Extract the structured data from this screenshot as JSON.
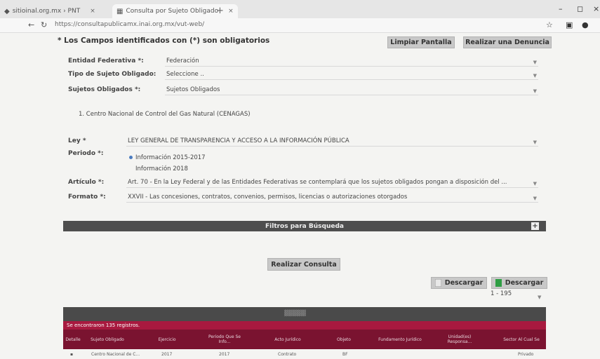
{
  "browser": {
    "tabs": [
      {
        "label": "sitioinal.org.mx › PNT",
        "active": false
      },
      {
        "label": "Consulta por Sujeto Obligado",
        "active": true
      }
    ],
    "url": "https://consultapublicamx.inai.org.mx/vut-web/"
  },
  "form": {
    "required_note": "* Los Campos identificados con (*) son obligatorios",
    "clear_button": "Limpiar Pantalla",
    "complaint_button": "Realizar una Denuncia",
    "entidad_label": "Entidad Federativa *:",
    "entidad_value": "Federación",
    "tipo_label": "Tipo de Sujeto Obligado:",
    "tipo_value": "Seleccione ..",
    "sujetos_label": "Sujetos Obligados *:",
    "sujetos_value": "Sujetos Obligados",
    "selected_subject": "1. Centro Nacional de Control del Gas Natural (CENAGAS)",
    "ley_label": "Ley *",
    "ley_value": "LEY GENERAL DE TRANSPARENCIA Y ACCESO A LA INFORMACIÓN PÚBLICA",
    "periodo_label": "Periodo *:",
    "periodo_options": [
      "Información 2015-2017",
      "Información 2018"
    ],
    "articulo_label": "Artículo *:",
    "articulo_value": "Art. 70 - En la Ley Federal y de las Entidades Federativas se contemplará que los sujetos obligados pongan a disposición del ...",
    "formato_label": "Formato *:",
    "formato_value": "XXVII - Las concesiones, contratos, convenios, permisos, licencias o autorizaciones otorgados"
  },
  "filters_label": "Filtros para Búsqueda",
  "query_button": "Realizar Consulta",
  "downloads": [
    "Descargar",
    "Descargar"
  ],
  "pager": "1 - 195",
  "results": {
    "count_text": "Se encontraron 135 registros.",
    "columns": [
      "Detalle",
      "Sujeto Obligado",
      "Ejercicio",
      "Periodo Que Se Info...",
      "Acto Jurídico",
      "Objeto",
      "Fundamento Jurídico",
      "Unidad(es) Responsa...",
      "Sector Al Cual Se"
    ],
    "row": [
      "Centro Nacional de C...",
      "2017",
      "2017",
      "Contrato",
      "BF",
      "",
      "",
      "Privado"
    ]
  },
  "colors": {
    "accent": "#a8193f",
    "header": "#7a1330",
    "bar": "#4e4e4e"
  }
}
